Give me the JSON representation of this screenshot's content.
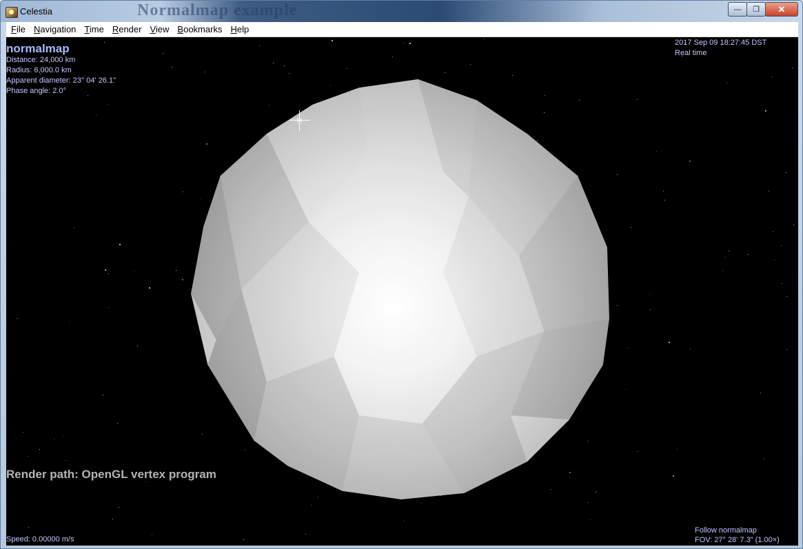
{
  "window": {
    "title": "Celestia",
    "ghost_title": "Normalmap example",
    "minimize": "—",
    "maximize": "❐",
    "close": "✕"
  },
  "menu": [
    {
      "label": "File",
      "key": "F",
      "rest": "ile"
    },
    {
      "label": "Navigation",
      "key": "N",
      "rest": "avigation"
    },
    {
      "label": "Time",
      "key": "T",
      "rest": "ime"
    },
    {
      "label": "Render",
      "key": "R",
      "rest": "ender"
    },
    {
      "label": "View",
      "key": "V",
      "rest": "iew"
    },
    {
      "label": "Bookmarks",
      "key": "B",
      "rest": "ookmarks"
    },
    {
      "label": "Help",
      "key": "H",
      "rest": "elp"
    }
  ],
  "hud": {
    "object_name": "normalmap",
    "distance": "Distance: 24,000 km",
    "radius": "Radius: 6,000.0 km",
    "apparent_diameter": "Apparent diameter: 23° 04' 26.1\"",
    "phase_angle": "Phase angle: 2.0°",
    "datetime": "2017 Sep 09 18:27:45 DST",
    "time_mode": "Real time",
    "render_path": "Render path: OpenGL vertex program",
    "speed": "Speed: 0.00000 m/s",
    "follow": "Follow normalmap",
    "fov": "FOV: 27° 28' 7.3\" (1.00×)"
  },
  "colors": {
    "hud_text": "#c2c8ff",
    "object_name": "#a9b8ff",
    "render_path": "#b4b4b4",
    "background": "#000000"
  }
}
